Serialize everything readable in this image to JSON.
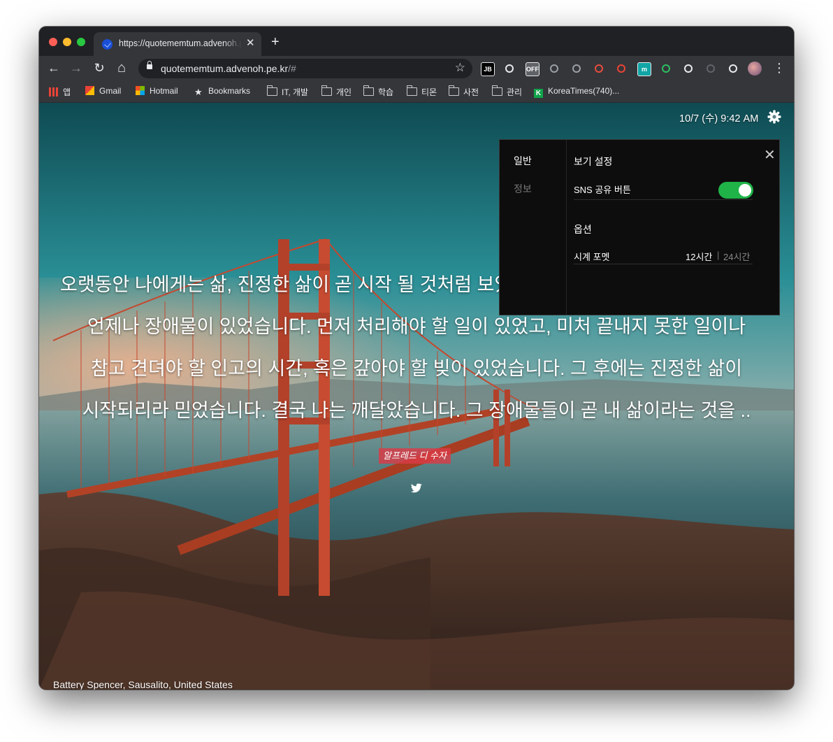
{
  "browser": {
    "tab_title": "https://quotememtum.advenoh.pe.kr/#",
    "tab_close": "✕",
    "new_tab": "+",
    "url_host": "quotememtum.advenoh.pe.kr",
    "url_rest": "/#",
    "nav_back": "←",
    "nav_forward": "→",
    "nav_reload": "↻",
    "nav_home": "⌂",
    "star": "☆",
    "menu": "⋮",
    "extensions": [
      {
        "icon": "jetbrains-icon",
        "label": "JB",
        "color": "#000000"
      },
      {
        "icon": "office-icon",
        "label": "",
        "color": "#e8eaed"
      },
      {
        "icon": "off-icon",
        "label": "OFF",
        "color": "#5f6368"
      },
      {
        "icon": "vue-icon",
        "label": "",
        "color": "#9aa0a6"
      },
      {
        "icon": "react-icon",
        "label": "",
        "color": "#9aa0a6"
      },
      {
        "icon": "asterisk-icon",
        "label": "",
        "color": "#e74c3c"
      },
      {
        "icon": "robot-icon",
        "label": "",
        "color": "#ea4335"
      },
      {
        "icon": "m-icon",
        "label": "m",
        "color": "#12a5a5"
      },
      {
        "icon": "evernote-icon",
        "label": "",
        "color": "#2dbe60"
      },
      {
        "icon": "target-icon",
        "label": "",
        "color": "#e8eaed"
      },
      {
        "icon": "info-icon",
        "label": "",
        "color": "#5f6368"
      },
      {
        "icon": "puzzle-icon",
        "label": "",
        "color": "#e8eaed"
      }
    ]
  },
  "bookmarks": [
    {
      "icon": "apps-icon",
      "label": "앱"
    },
    {
      "icon": "gmail-icon",
      "label": "Gmail"
    },
    {
      "icon": "microsoft-icon",
      "label": "Hotmail"
    },
    {
      "icon": "star-icon",
      "label": "Bookmarks"
    },
    {
      "icon": "folder-icon",
      "label": "IT, 개발"
    },
    {
      "icon": "folder-icon",
      "label": "개인"
    },
    {
      "icon": "folder-icon",
      "label": "학습"
    },
    {
      "icon": "folder-icon",
      "label": "티몬"
    },
    {
      "icon": "folder-icon",
      "label": "사전"
    },
    {
      "icon": "folder-icon",
      "label": "관리"
    },
    {
      "icon": "koreatimes-icon",
      "label": "KoreaTimes(740)..."
    }
  ],
  "page": {
    "clock": "10/7 (수) 9:42 AM",
    "quote_lines": [
      "오랫동안 나에게는 삶, 진정한 삶이 곧 시작 될 것처럼 보였습니다. 하지만 그렇지 않았습니다.",
      "언제나 장애물이 있었습니다. 먼저 처리해야 할 일이 있었고, 미처 끝내지 못한 일이나",
      "참고 견뎌야 할 인고의 시간, 혹은 갚아야 할 빚이 있었습니다. 그 후에는 진정한 삶이",
      "시작되리라 믿었습니다. 결국 나는 깨달았습니다. 그 장애물들이 곧 내 삶이라는 것을 .."
    ],
    "author": "알프레드 디 수자",
    "location": "Battery Spencer, Sausalito, United States"
  },
  "settings": {
    "menu": [
      "일반",
      "정보"
    ],
    "view_title": "보기 설정",
    "sns_label": "SNS 공유 버튼",
    "sns_enabled": true,
    "options_title": "옵션",
    "clock_format_label": "시계 포멧",
    "format_12": "12시간",
    "format_sep": "|",
    "format_24": "24시간",
    "close": "✕"
  }
}
